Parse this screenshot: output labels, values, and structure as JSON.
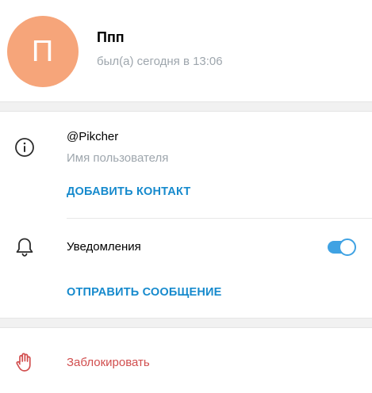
{
  "profile": {
    "avatar_letter": "П",
    "avatar_color": "#f6a57a",
    "name": "Ппп",
    "status": "был(а) сегодня в 13:06"
  },
  "info": {
    "icon": "info-icon",
    "username": "@Pikcher",
    "username_caption": "Имя пользователя",
    "add_contact_label": "ДОБАВИТЬ КОНТАКТ"
  },
  "notifications": {
    "icon": "bell-icon",
    "label": "Уведомления",
    "enabled": true,
    "send_message_label": "ОТПРАВИТЬ СООБЩЕНИЕ"
  },
  "block": {
    "icon": "hand-stop-icon",
    "label": "Заблокировать",
    "color": "#d14e4e"
  },
  "colors": {
    "accent": "#168acd",
    "toggle_on": "#3fa2e3",
    "secondary_text": "#9ea6ad"
  }
}
